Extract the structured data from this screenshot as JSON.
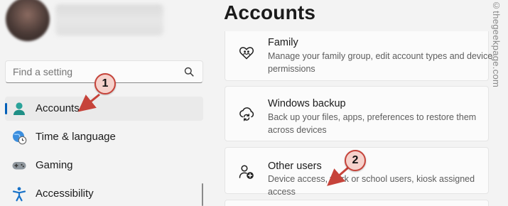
{
  "search": {
    "placeholder": "Find a setting"
  },
  "sidebar": {
    "items": [
      {
        "label": "Accounts"
      },
      {
        "label": "Time & language"
      },
      {
        "label": "Gaming"
      },
      {
        "label": "Accessibility"
      }
    ]
  },
  "main": {
    "title": "Accounts",
    "cards": [
      {
        "icon": "family-heart-icon",
        "title": "Family",
        "description": "Manage your family group, edit account types and device permissions"
      },
      {
        "icon": "windows-backup-icon",
        "title": "Windows backup",
        "description": "Back up your files, apps, preferences to restore them across devices"
      },
      {
        "icon": "add-user-icon",
        "title": "Other users",
        "description": "Device access, work or school users, kiosk assigned access"
      }
    ]
  },
  "annotations": {
    "step1": "1",
    "step2": "2"
  },
  "watermark": "©thegeekpage.com",
  "colors": {
    "accent": "#005fb8",
    "annotation": "#c6433a",
    "annotation_fill": "#f6d2cc"
  }
}
